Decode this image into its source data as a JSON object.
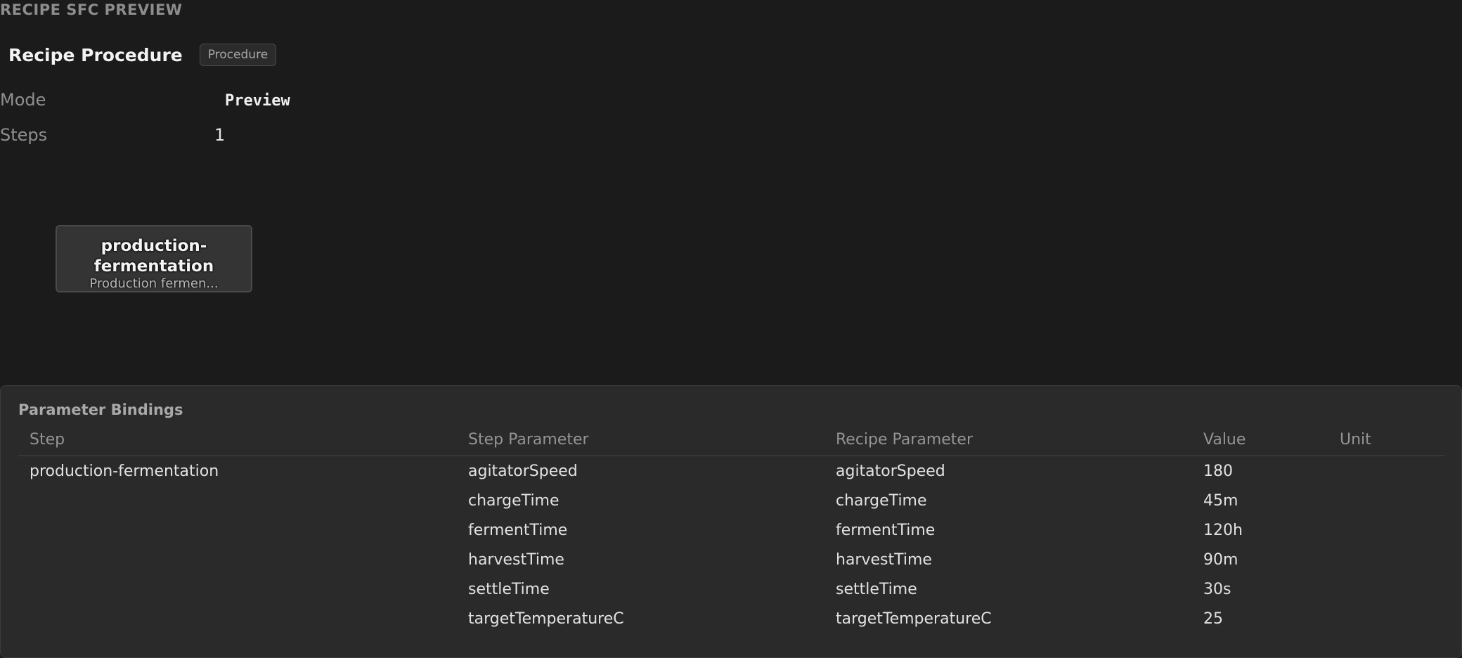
{
  "section_title": "RECIPE SFC PREVIEW",
  "procedure": {
    "title": "Recipe Procedure",
    "badge": "Procedure"
  },
  "info": {
    "mode_label": "Mode",
    "mode_value": "Preview",
    "steps_label": "Steps",
    "steps_value": "1"
  },
  "sfc_step": {
    "name": "production-fermentation",
    "description": "Production fermen..."
  },
  "bindings": {
    "title": "Parameter Bindings",
    "columns": [
      "Step",
      "Step Parameter",
      "Recipe Parameter",
      "Value",
      "Unit"
    ],
    "rows": [
      {
        "step": "production-fermentation",
        "step_param": "agitatorSpeed",
        "recipe_param": "agitatorSpeed",
        "value": "180",
        "unit": ""
      },
      {
        "step": "",
        "step_param": "chargeTime",
        "recipe_param": "chargeTime",
        "value": "45m",
        "unit": ""
      },
      {
        "step": "",
        "step_param": "fermentTime",
        "recipe_param": "fermentTime",
        "value": "120h",
        "unit": ""
      },
      {
        "step": "",
        "step_param": "harvestTime",
        "recipe_param": "harvestTime",
        "value": "90m",
        "unit": ""
      },
      {
        "step": "",
        "step_param": "settleTime",
        "recipe_param": "settleTime",
        "value": "30s",
        "unit": ""
      },
      {
        "step": "",
        "step_param": "targetTemperatureC",
        "recipe_param": "targetTemperatureC",
        "value": "25",
        "unit": ""
      }
    ]
  }
}
